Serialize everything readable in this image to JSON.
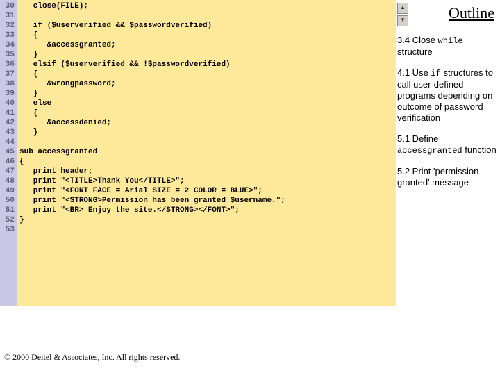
{
  "gutter_start": 30,
  "gutter_end": 53,
  "code_lines": [
    "   close(FILE);",
    "",
    "   if ($userverified && $passwordverified)",
    "   {",
    "      &accessgranted;",
    "   }",
    "   elsif ($userverified && !$passwordverified)",
    "   {",
    "      &wrongpassword;",
    "   }",
    "   else",
    "   {",
    "      &accessdenied;",
    "   }",
    "",
    "sub accessgranted",
    "{",
    "   print header;",
    "   print \"<TITLE>Thank You</TITLE>\";",
    "   print \"<FONT FACE = Arial SIZE = 2 COLOR = BLUE>\";",
    "   print \"<STRONG>Permission has been granted $username.\";",
    "   print \"<BR> Enjoy the site.</STRONG></FONT>\";",
    "}",
    ""
  ],
  "outline_title": "Outline",
  "notes": {
    "n1_a": "3.4 Close ",
    "n1_b": "while",
    "n1_c": " structure",
    "n2_a": "4.1 Use ",
    "n2_b": "if",
    "n2_c": " structures to call user-defined programs depending on outcome of password verification",
    "n3_a": "5.1 Define ",
    "n3_b": "accessgranted",
    "n3_c": " function",
    "n4": "5.2 Print 'permission granted' message"
  },
  "nav": {
    "up": "▲",
    "down": "▼"
  },
  "footer": " 2000 Deitel & Associates, Inc.  All rights reserved.",
  "copyright_glyph": "©"
}
